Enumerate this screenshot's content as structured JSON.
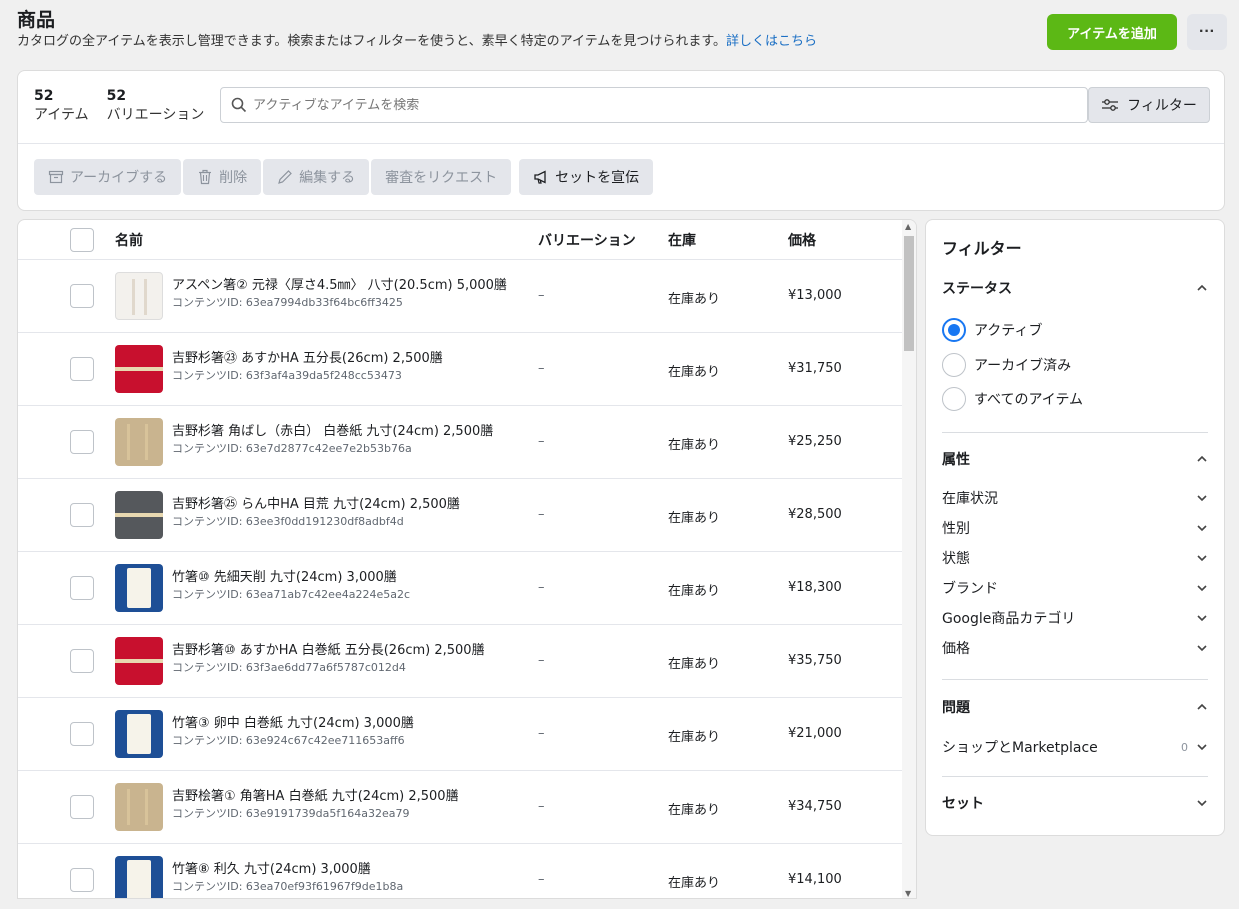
{
  "header": {
    "title": "商品",
    "description": "カタログの全アイテムを表示し管理できます。検索またはフィルターを使うと、素早く特定のアイテムを見つけられます。",
    "learn_more": "詳しくはこちら",
    "add_item": "アイテムを追加",
    "more": "···"
  },
  "summary": {
    "items_count": "52",
    "items_label": "アイテム",
    "variations_count": "52",
    "variations_label": "バリエーション"
  },
  "search": {
    "placeholder": "アクティブなアイテムを検索"
  },
  "filter_button": "フィルター",
  "actions": {
    "archive": "アーカイブする",
    "delete": "削除",
    "edit": "編集する",
    "review": "審査をリクエスト",
    "promote": "セットを宣伝"
  },
  "table": {
    "headers": {
      "name": "名前",
      "variation": "バリエーション",
      "stock": "在庫",
      "price": "価格"
    },
    "rows": [
      {
        "name": "アスペン箸② 元禄〈厚さ4.5㎜〉 八寸(20.5cm) 5,000膳",
        "content_id": "コンテンツID: 63ea7994db33f64bc6ff3425",
        "variation": "–",
        "stock": "在庫あり",
        "price": "¥13,000",
        "thumb": "white"
      },
      {
        "name": "吉野杉箸㉓ あすかHA 五分長(26cm) 2,500膳",
        "content_id": "コンテンツID: 63f3af4a39da5f248cc53473",
        "variation": "–",
        "stock": "在庫あり",
        "price": "¥31,750",
        "thumb": "red"
      },
      {
        "name": "吉野杉箸 角ばし（赤白） 白巻紙 九寸(24cm) 2,500膳",
        "content_id": "コンテンツID: 63e7d2877c42ee7e2b53b76a",
        "variation": "–",
        "stock": "在庫あり",
        "price": "¥25,250",
        "thumb": "beige"
      },
      {
        "name": "吉野杉箸㉕ らん中HA 目荒 九寸(24cm) 2,500膳",
        "content_id": "コンテンツID: 63ee3f0dd191230df8adbf4d",
        "variation": "–",
        "stock": "在庫あり",
        "price": "¥28,500",
        "thumb": "gray"
      },
      {
        "name": "竹箸⑩ 先細天削 九寸(24cm) 3,000膳",
        "content_id": "コンテンツID: 63ea71ab7c42ee4a224e5a2c",
        "variation": "–",
        "stock": "在庫あり",
        "price": "¥18,300",
        "thumb": "blue"
      },
      {
        "name": "吉野杉箸⑩ あすかHA 白巻紙 五分長(26cm) 2,500膳",
        "content_id": "コンテンツID: 63f3ae6dd77a6f5787c012d4",
        "variation": "–",
        "stock": "在庫あり",
        "price": "¥35,750",
        "thumb": "red"
      },
      {
        "name": "竹箸③ 卵中 白巻紙 九寸(24cm) 3,000膳",
        "content_id": "コンテンツID: 63e924c67c42ee711653aff6",
        "variation": "–",
        "stock": "在庫あり",
        "price": "¥21,000",
        "thumb": "blue"
      },
      {
        "name": "吉野桧箸① 角箸HA 白巻紙 九寸(24cm) 2,500膳",
        "content_id": "コンテンツID: 63e9191739da5f164a32ea79",
        "variation": "–",
        "stock": "在庫あり",
        "price": "¥34,750",
        "thumb": "beige"
      },
      {
        "name": "竹箸⑧ 利久 九寸(24cm) 3,000膳",
        "content_id": "コンテンツID: 63ea70ef93f61967f9de1b8a",
        "variation": "–",
        "stock": "在庫あり",
        "price": "¥14,100",
        "thumb": "blue"
      }
    ]
  },
  "filters": {
    "title": "フィルター",
    "status_title": "ステータス",
    "status_options": [
      "アクティブ",
      "アーカイブ済み",
      "すべてのアイテム"
    ],
    "attributes_title": "属性",
    "attributes": [
      "在庫状況",
      "性別",
      "状態",
      "ブランド",
      "Google商品カテゴリ",
      "価格"
    ],
    "issues_title": "問題",
    "issues_item": "ショップとMarketplace",
    "issues_count": "0",
    "sets_title": "セット"
  },
  "colors": {
    "primary_green": "#5cb815",
    "link_blue": "#1b6fc4",
    "radio_blue": "#1877f2"
  }
}
